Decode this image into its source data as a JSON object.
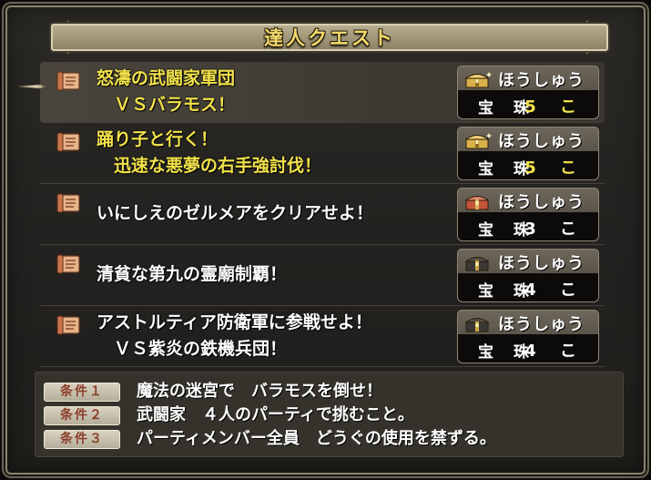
{
  "window": {
    "title": "達人クエスト"
  },
  "quests": [
    {
      "line1": "怒濤の武闘家軍団",
      "line2": "　ＶＳバラモス！",
      "highlight": true,
      "selected": true,
      "reward_label": "ほうしゅう",
      "reward_item": "宝 珠",
      "reward_count": "5 こ",
      "chest": "gold-chest-icon"
    },
    {
      "line1": "踊り子と行く！",
      "line2": "　迅速な悪夢の右手強討伐！",
      "highlight": true,
      "selected": false,
      "reward_label": "ほうしゅう",
      "reward_item": "宝 珠",
      "reward_count": "5 こ",
      "chest": "gold-chest-icon"
    },
    {
      "line1": "いにしえのゼルメアをクリアせよ！",
      "line2": "",
      "highlight": false,
      "selected": false,
      "reward_label": "ほうしゅう",
      "reward_item": "宝 珠",
      "reward_count": "3 こ",
      "chest": "red-chest-icon"
    },
    {
      "line1": "清貧な第九の霊廟制覇！",
      "line2": "",
      "highlight": false,
      "selected": false,
      "reward_label": "ほうしゅう",
      "reward_item": "宝 珠",
      "reward_count": "4 こ",
      "chest": "black-chest-icon"
    },
    {
      "line1": "アストルティア防衛軍に参戦せよ！",
      "line2": "　ＶＳ紫炎の鉄機兵団！",
      "highlight": false,
      "selected": false,
      "reward_label": "ほうしゅう",
      "reward_item": "宝 珠",
      "reward_count": "4 こ",
      "chest": "black-chest-icon"
    }
  ],
  "conditions": [
    {
      "tag": "条件１",
      "text": "魔法の迷宮で　バラモスを倒せ！"
    },
    {
      "tag": "条件２",
      "text": "武闘家　４人のパーティで挑むこと。"
    },
    {
      "tag": "条件３",
      "text": "パーティメンバー全員　どうぐの使用を禁ずる。"
    }
  ],
  "colors": {
    "highlight_text": "#f2e24a",
    "title_text": "#f2da6b",
    "tag_text": "#8a3e28"
  },
  "icons": {
    "quest": "scroll-icon",
    "cursor": "pointer-cursor-icon"
  }
}
